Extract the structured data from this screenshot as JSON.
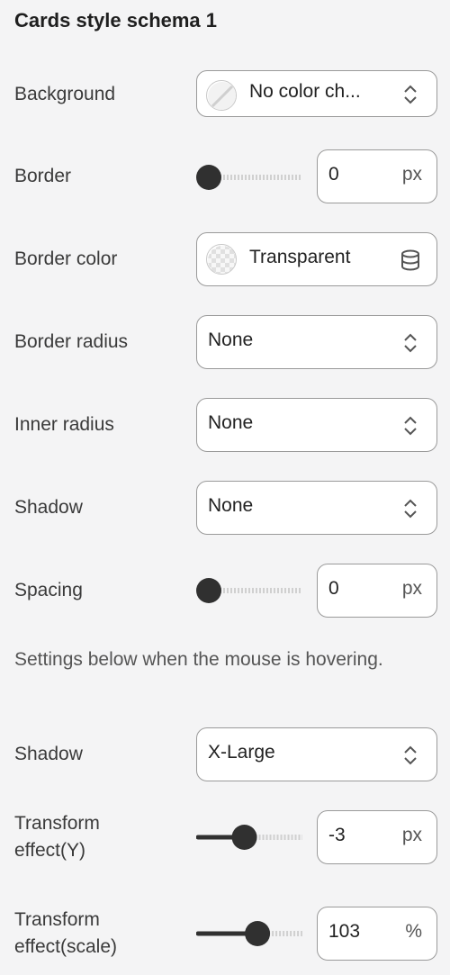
{
  "panel": {
    "title": "Cards style schema 1"
  },
  "background": {
    "label": "Background",
    "value": "No color ch..."
  },
  "border": {
    "label": "Border",
    "value": "0",
    "unit": "px",
    "slider_level": 0
  },
  "border_color": {
    "label": "Border color",
    "value": "Transparent"
  },
  "border_radius": {
    "label": "Border radius",
    "value": "None"
  },
  "inner_radius": {
    "label": "Inner radius",
    "value": "None"
  },
  "shadow": {
    "label": "Shadow",
    "value": "None"
  },
  "spacing": {
    "label": "Spacing",
    "value": "0",
    "unit": "px",
    "slider_level": 0
  },
  "hover_note": "Settings below when the mouse is hovering.",
  "hover_shadow": {
    "label": "Shadow",
    "value": "X-Large"
  },
  "transform_y": {
    "label_line1": "Transform",
    "label_line2": "effect(Y)",
    "value": "-3",
    "unit": "px",
    "slider_level": 0.38
  },
  "transform_scale": {
    "label_line1": "Transform",
    "label_line2": "effect(scale)",
    "value": "103",
    "unit": "%",
    "slider_level": 0.52
  },
  "icons": {
    "chevron": "chevron-up-down-icon",
    "database": "database-icon",
    "no_color": "no-color-swatch-icon",
    "transparent": "transparent-swatch-icon"
  },
  "colors": {
    "accent": "#303030",
    "track": "#d0d0d0",
    "border": "#9a9a9a"
  }
}
